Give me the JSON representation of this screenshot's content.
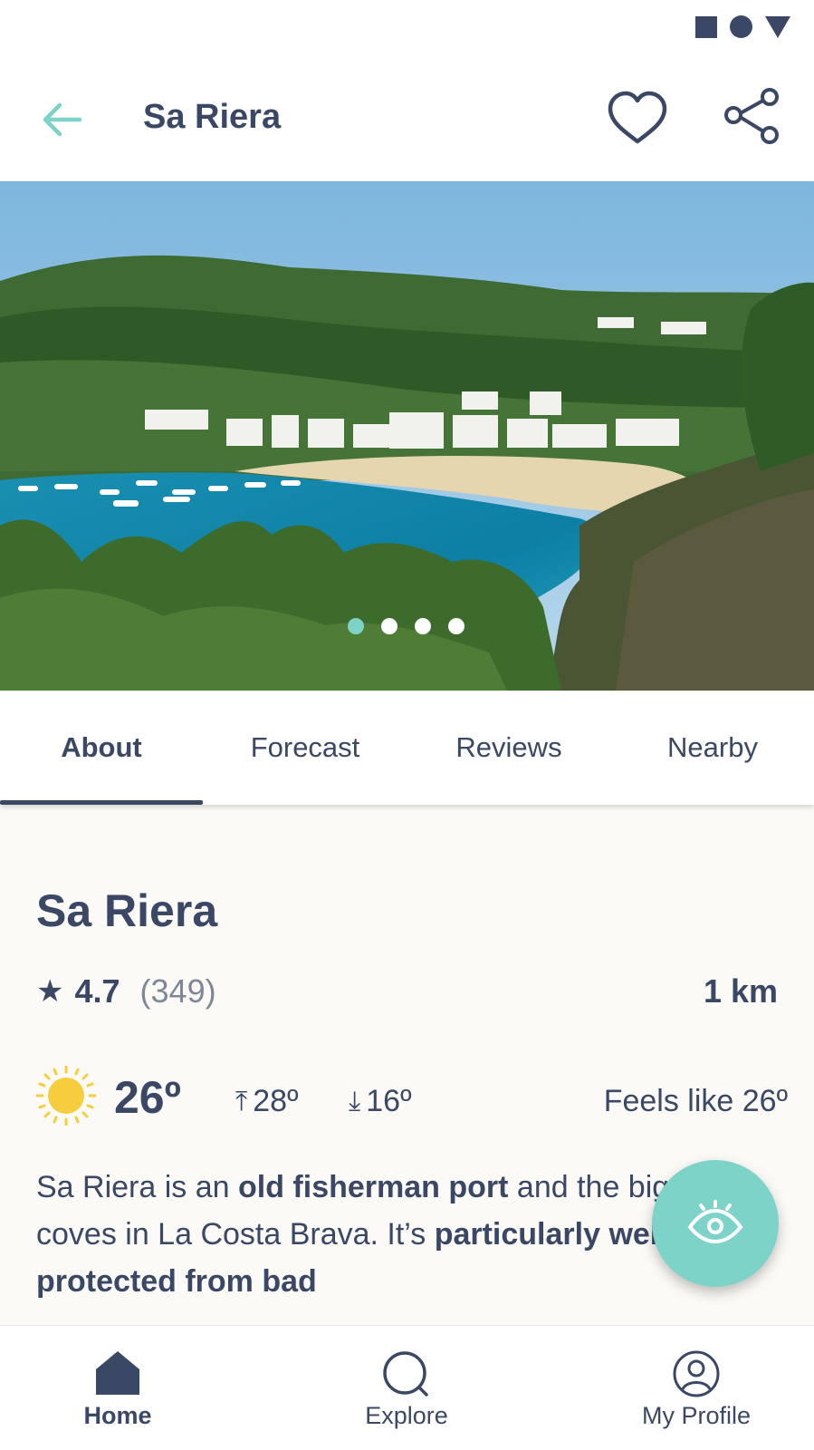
{
  "status_bar": {
    "icons": [
      "square-icon",
      "circle-icon",
      "triangle-icon"
    ]
  },
  "app_bar": {
    "title": "Sa Riera",
    "back_icon": "arrow-left-icon",
    "favorite_icon": "heart-icon",
    "share_icon": "share-icon"
  },
  "gallery": {
    "image": "beach-cove-photo",
    "dots": 4,
    "active_dot": 0
  },
  "tabs": [
    {
      "label": "About",
      "active": true
    },
    {
      "label": "Forecast",
      "active": false
    },
    {
      "label": "Reviews",
      "active": false
    },
    {
      "label": "Nearby",
      "active": false
    }
  ],
  "place": {
    "title": "Sa Riera",
    "rating": "4.7",
    "review_count": "(349)",
    "distance": "1 km"
  },
  "weather": {
    "icon": "sun-icon",
    "temperature": "26º",
    "high": "28º",
    "low": "16º",
    "feels_like": "Feels like 26º"
  },
  "description": {
    "t1": "Sa Riera is an ",
    "b1": "old fisherman port",
    "t2": " and the biggest coves in La Costa Brava. It’s ",
    "b2": "particularly well protected from bad"
  },
  "fab": {
    "icon": "eye-icon"
  },
  "bottom_nav": [
    {
      "label": "Home",
      "icon": "home-icon",
      "active": true
    },
    {
      "label": "Explore",
      "icon": "search-icon",
      "active": false
    },
    {
      "label": "My Profile",
      "icon": "profile-icon",
      "active": false
    }
  ],
  "colors": {
    "primary": "#3b4865",
    "accent": "#7dd3c8",
    "sun": "#f6cd3c",
    "background": "#fbfaf6"
  }
}
